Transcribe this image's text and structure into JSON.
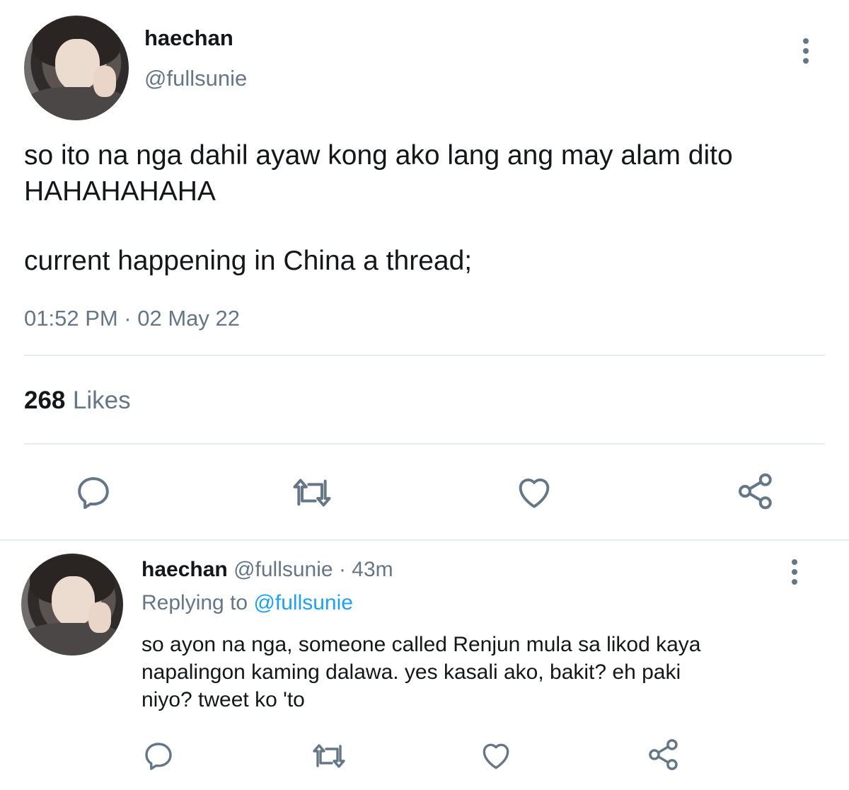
{
  "tweet": {
    "author_name": "haechan",
    "author_handle": "@fullsunie",
    "text_line1": "so ito na nga dahil ayaw kong ako lang ang may alam dito",
    "text_line2": "HAHAHAHAHA",
    "text_line3": "current happening in China a thread;",
    "timestamp": "01:52 PM · 02 May 22",
    "likes_count": "268",
    "likes_label": "Likes"
  },
  "reply": {
    "author_name": "haechan",
    "author_handle": "@fullsunie",
    "time_ago": "· 43m",
    "replying_prefix": "Replying to",
    "replying_handle": "@fullsunie",
    "text_line1": "so ayon na nga, someone called Renjun mula sa likod kaya",
    "text_line2": "napalingon kaming dalawa. yes kasali ako, bakit? eh paki",
    "text_line3": "niyo? tweet ko 'to"
  },
  "icons": {
    "reply": "reply-icon",
    "retweet": "retweet-icon",
    "like": "heart-icon",
    "share": "share-icon",
    "more": "more-options-icon"
  },
  "colors": {
    "text": "#14171a",
    "secondary": "#657786",
    "link": "#1da1f2",
    "divider": "#e6ecf0"
  }
}
